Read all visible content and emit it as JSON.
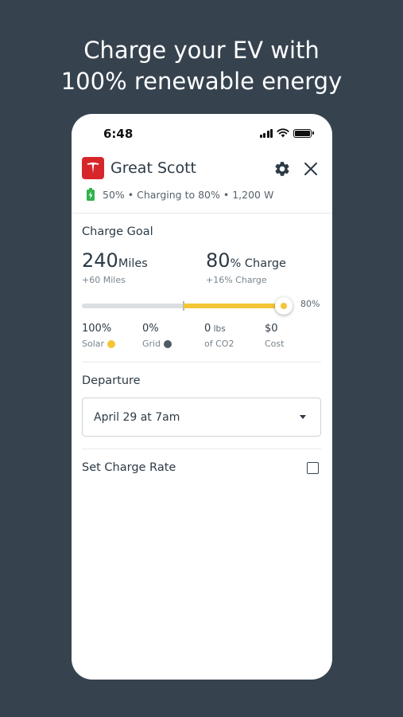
{
  "headline": {
    "line1": "Charge your EV with",
    "line2": "100% renewable energy"
  },
  "status_bar": {
    "time": "6:48"
  },
  "vehicle": {
    "name": "Great Scott",
    "status_text": "50% • Charging to 80% • 1,200 W",
    "brand_color": "#d7262b"
  },
  "charge_goal": {
    "title": "Charge Goal",
    "miles_value": "240",
    "miles_unit": "Miles",
    "miles_delta": "+60 Miles",
    "charge_value": "80",
    "charge_unit": "% Charge",
    "charge_delta": "+16% Charge",
    "slider": {
      "current_percent": 50,
      "target_percent": 80,
      "label": "80%",
      "fill_color": "#f4c535"
    },
    "stats": [
      {
        "value": "100",
        "value_unit": "%",
        "label": "Solar"
      },
      {
        "value": "0",
        "value_unit": "%",
        "label": "Grid"
      },
      {
        "value": "0",
        "value_unit": " lbs",
        "label": "of CO2"
      },
      {
        "value": "$0",
        "value_unit": "",
        "label": "Cost"
      }
    ]
  },
  "departure": {
    "title": "Departure",
    "selected": "April 29 at 7am"
  },
  "charge_rate": {
    "label": "Set Charge Rate",
    "checked": false
  },
  "colors": {
    "background": "#36434f",
    "accent_yellow": "#f4c535",
    "grid_dot": "#4e5a66",
    "battery_green": "#2fb24c"
  }
}
